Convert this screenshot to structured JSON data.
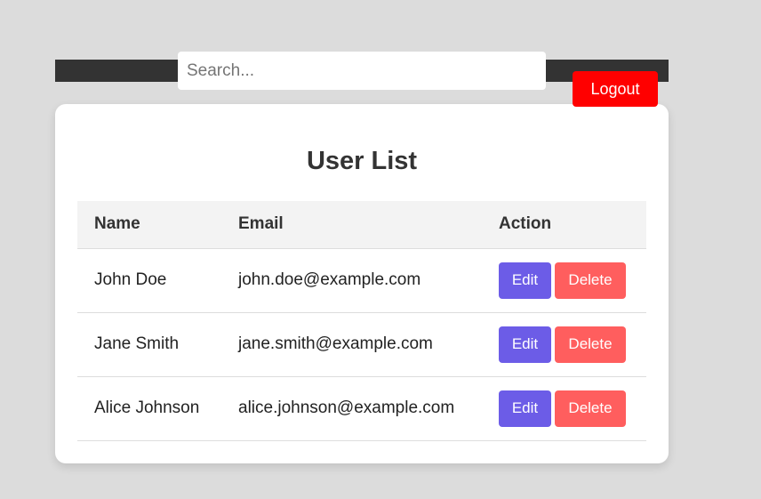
{
  "header": {
    "search_placeholder": "Search...",
    "logout_label": "Logout"
  },
  "main": {
    "title": "User List",
    "columns": [
      "Name",
      "Email",
      "Action"
    ],
    "rows": [
      {
        "name": "John Doe",
        "email": "john.doe@example.com",
        "edit_label": "Edit",
        "delete_label": "Delete"
      },
      {
        "name": "Jane Smith",
        "email": "jane.smith@example.com",
        "edit_label": "Edit",
        "delete_label": "Delete"
      },
      {
        "name": "Alice Johnson",
        "email": "alice.johnson@example.com",
        "edit_label": "Edit",
        "delete_label": "Delete"
      }
    ]
  },
  "colors": {
    "topbar": "#333333",
    "logout": "#ff0000",
    "edit": "#6c5ce7",
    "delete": "#ff5e5e"
  }
}
